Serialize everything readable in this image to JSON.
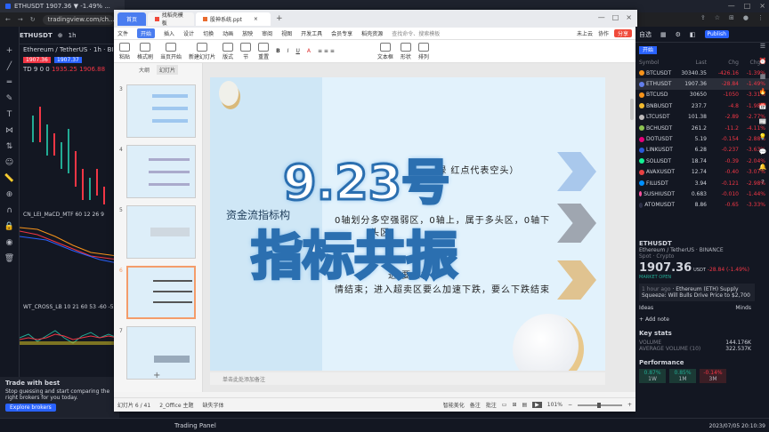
{
  "browser": {
    "tab_title": "ETHUSDT 1907.36 ▼ -1.49% ...",
    "url": "tradingview.com/ch...",
    "controls": [
      "—",
      "□",
      "×"
    ]
  },
  "tv_left": {
    "symbol": "ETHUSDT",
    "interval": "1h",
    "legend_title": "Ethereum / TetherUS · 1h · BINANCE",
    "price_sell": "1907.36",
    "price_buy": "1907.37",
    "td_line": "TD 9 0 0",
    "td_values": "1935.25  1906.88",
    "indicator_macd": "CN_LEI_MaCD_MTF 60 12 26 9",
    "indicator_cross": "WT_CROSS_LB 10 21 60 53 -60 -53",
    "trade_title": "Trade with best",
    "trade_text": "Stop guessing and start comparing the right brokers for you today.",
    "trade_button": "Explore brokers",
    "bottom_panel": "Trading Panel"
  },
  "wps": {
    "tabs": {
      "home": "首页",
      "templates": "找稻壳模板",
      "file": "股神系统.ppt"
    },
    "menu": [
      "文件",
      "开始",
      "插入",
      "设计",
      "切换",
      "动画",
      "放映",
      "审阅",
      "视图",
      "开发工具",
      "会员专享",
      "稻壳资源"
    ],
    "menu_search": "查找命令、搜索模板",
    "menu_right": {
      "cloud": "未上云",
      "collab": "协作",
      "share": "分享"
    },
    "ribbon": [
      "粘贴",
      "格式刷",
      "当页开始",
      "新建幻灯片",
      "版式",
      "节",
      "重置",
      "文本框",
      "形状",
      "排列"
    ],
    "panel_tabs": [
      "大纲",
      "幻灯片"
    ],
    "slide_numbers": [
      "3",
      "4",
      "5",
      "6",
      "7"
    ],
    "slide": {
      "title": "资金流指标构",
      "line1": "绿     红点代表空头）",
      "line1_prefix": "辆",
      "line2": "0轴划分多空强弱区，0轴上，属于多头区，0轴下",
      "line2b": "头区",
      "line3": "进     要么行",
      "line3b": "情结束；进入超卖区要么加速下跌，要么下跌结束"
    },
    "overlay_line1": "9.23号",
    "overlay_line2": "指标共振",
    "notes_placeholder": "单击此处添加备注",
    "status": {
      "slide_info": "幻灯片 6 / 41",
      "theme": "2_Office 主题",
      "missing_font": "缺失字体",
      "beautify": "智能美化",
      "notes": "备注",
      "comments": "批注",
      "zoom": "101%"
    }
  },
  "tv_right": {
    "watchlist_title": "自选",
    "publish": "Publish",
    "list_name": "开始",
    "columns": [
      "Symbol",
      "Last",
      "Chg",
      "Chg%"
    ],
    "rows": [
      {
        "sym": "BTCUSDT",
        "last": "30340.35",
        "chg": "-426.16",
        "chgp": "-1.39%"
      },
      {
        "sym": "ETHUSDT",
        "last": "1907.36",
        "chg": "-28.84",
        "chgp": "-1.49%"
      },
      {
        "sym": "BTCUSD",
        "last": "30650",
        "chg": "-1050",
        "chgp": "-3.31%"
      },
      {
        "sym": "BNBUSDT",
        "last": "237.7",
        "chg": "-4.8",
        "chgp": "-1.98%"
      },
      {
        "sym": "LTCUSDT",
        "last": "101.38",
        "chg": "-2.89",
        "chgp": "-2.77%"
      },
      {
        "sym": "BCHUSDT",
        "last": "261.2",
        "chg": "-11.2",
        "chgp": "-4.11%"
      },
      {
        "sym": "DOTUSDT",
        "last": "5.19",
        "chg": "-0.154",
        "chgp": "-2.88%"
      },
      {
        "sym": "LINKUSDT",
        "last": "6.28",
        "chg": "-0.237",
        "chgp": "-3.63%"
      },
      {
        "sym": "SOLUSDT",
        "last": "18.74",
        "chg": "-0.39",
        "chgp": "-2.04%"
      },
      {
        "sym": "AVAXUSDT",
        "last": "12.74",
        "chg": "-0.40",
        "chgp": "-3.07%"
      },
      {
        "sym": "FILUSDT",
        "last": "3.94",
        "chg": "-0.121",
        "chgp": "-2.98%"
      },
      {
        "sym": "SUSHIUSDT",
        "last": "0.683",
        "chg": "-0.010",
        "chgp": "-1.44%"
      },
      {
        "sym": "ATOMUSDT",
        "last": "8.86",
        "chg": "-0.65",
        "chgp": "-3.33%"
      }
    ],
    "detail": {
      "symbol": "ETHUSDT",
      "name": "Ethereum / TetherUS · BINANCE",
      "category": "Spot · Crypto",
      "price": "1907.36",
      "currency": "USDT",
      "change": "-28.84 (-1.49%)",
      "market_status": "MARKET OPEN",
      "news_time": "1 hour ago",
      "news_text": "Ethereum (ETH) Supply Squeeze: Will Bulls Drive Price to $2,700",
      "ideas": "Ideas",
      "minds": "Minds",
      "add_note": "Add note",
      "key_stats": "Key stats",
      "volume_label": "VOLUME",
      "volume": "144.176K",
      "avg_volume_label": "AVERAGE VOLUME (10)",
      "avg_volume": "322.537K",
      "performance": "Performance",
      "perf": [
        {
          "value": "0.87%",
          "period": "1W"
        },
        {
          "value": "0.85%",
          "period": "1M"
        },
        {
          "value": "-0.14%",
          "period": "3M"
        }
      ]
    },
    "clock": "2023/07/05 20:10:39"
  }
}
